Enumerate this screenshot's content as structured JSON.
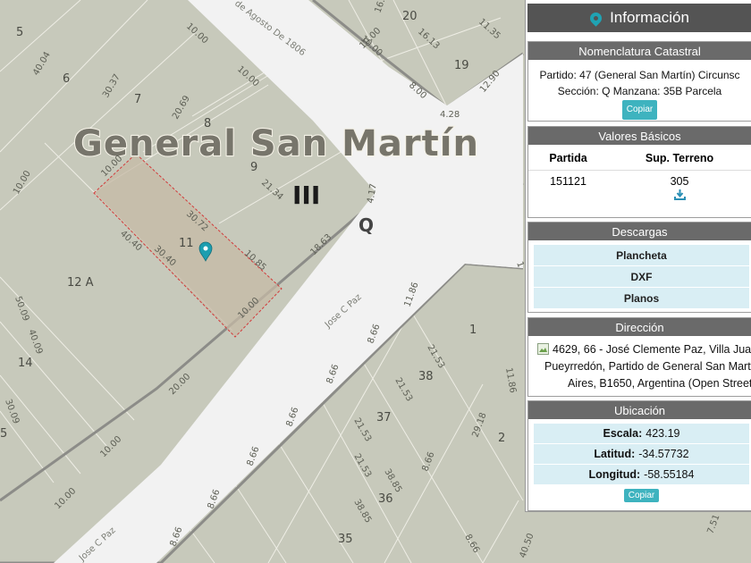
{
  "map": {
    "city_label": "General San Martín",
    "district_label": "III",
    "block_label": "Q",
    "streets": [
      "Jose C Paz",
      "Jose C Paz",
      "de Agosto De 1806"
    ],
    "lots": [
      "5",
      "6",
      "7",
      "8",
      "9",
      "11",
      "12 A",
      "14",
      "20",
      "19",
      "1",
      "2",
      "35",
      "36",
      "37",
      "38",
      "5"
    ],
    "dimensions": [
      "40.04",
      "30.37",
      "10.00",
      "10.00",
      "20.69",
      "10.00",
      "10.00",
      "10.00",
      "30.72",
      "40.40",
      "30.40",
      "10.85",
      "21.34",
      "4.17",
      "18.63",
      "10.00",
      "16.5",
      "16.13",
      "11.35",
      "12.90",
      "8.00",
      "10.00",
      "4.28",
      "50.09",
      "40.09",
      "30.09",
      "20.00",
      "10.00",
      "10.00",
      "11.86",
      "8.66",
      "21.53",
      "21.53",
      "8.66",
      "8.66",
      "8.66",
      "21.53",
      "29.18",
      "38.85",
      "38.85",
      "8.66",
      "8.66",
      "8.66",
      "8.66",
      "21.53",
      "11.86",
      "40.50",
      "7.51",
      "1"
    ]
  },
  "panel": {
    "title": "Información",
    "nomenclatura": {
      "title": "Nomenclatura Catastral",
      "line1": "Partido: 47 (General San Martín) Circunsc",
      "line2": "Sección: Q Manzana: 35B Parcela",
      "copy": "Copiar"
    },
    "valores": {
      "title": "Valores Básicos",
      "col1": "Partida",
      "col2": "Sup. Terreno",
      "partida": "151121",
      "superficie": "305"
    },
    "descargas": {
      "title": "Descargas",
      "items": [
        "Plancheta",
        "DXF",
        "Planos"
      ]
    },
    "direccion": {
      "title": "Dirección",
      "line1_pre": "4629, 66 -",
      "line1_rest": " José Clemente Paz, Villa Jua",
      "line2": "Pueyrredón, Partido de General San Marti",
      "line3": "Aires, B1650, Argentina (Open Street"
    },
    "ubicacion": {
      "title": "Ubicación",
      "escala_label": "Escala:",
      "escala": "423.19",
      "latitud_label": "Latitud:",
      "latitud": "-34.57732",
      "longitud_label": "Longitud:",
      "longitud": "-58.55184",
      "copy": "Copiar"
    }
  }
}
